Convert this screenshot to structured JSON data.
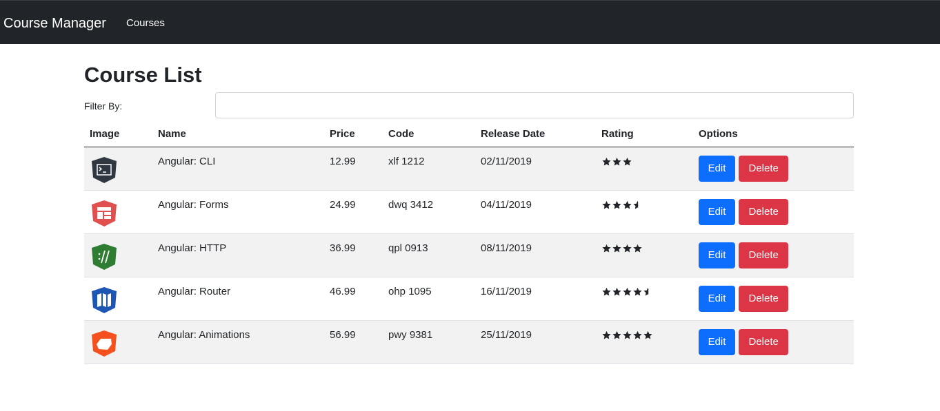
{
  "navbar": {
    "brand": "Course Manager",
    "links": [
      "Courses"
    ]
  },
  "page": {
    "title": "Course List",
    "filter_label": "Filter By:",
    "filter_value": ""
  },
  "table": {
    "headers": [
      "Image",
      "Name",
      "Price",
      "Code",
      "Release Date",
      "Rating",
      "Options"
    ],
    "rows": [
      {
        "icon": "cli-terminal-icon",
        "icon_color": "#2f3740",
        "name": "Angular: CLI",
        "price": "12.99",
        "code": "xlf 1212",
        "release_date": "02/11/2019",
        "rating": 3,
        "edit_label": "Edit",
        "delete_label": "Delete"
      },
      {
        "icon": "forms-icon",
        "icon_color": "#e0504f",
        "name": "Angular: Forms",
        "price": "24.99",
        "code": "dwq 3412",
        "release_date": "04/11/2019",
        "rating": 3.5,
        "edit_label": "Edit",
        "delete_label": "Delete"
      },
      {
        "icon": "http-icon",
        "icon_color": "#2e7d32",
        "name": "Angular: HTTP",
        "price": "36.99",
        "code": "qpl 0913",
        "release_date": "08/11/2019",
        "rating": 4,
        "edit_label": "Edit",
        "delete_label": "Delete"
      },
      {
        "icon": "router-map-icon",
        "icon_color": "#1e56b4",
        "name": "Angular: Router",
        "price": "46.99",
        "code": "ohp 1095",
        "release_date": "16/11/2019",
        "rating": 4.5,
        "edit_label": "Edit",
        "delete_label": "Delete"
      },
      {
        "icon": "animations-icon",
        "icon_color": "#f4511e",
        "name": "Angular: Animations",
        "price": "56.99",
        "code": "pwy 9381",
        "release_date": "25/11/2019",
        "rating": 5,
        "edit_label": "Edit",
        "delete_label": "Delete"
      }
    ]
  },
  "colors": {
    "navbar_bg": "#212529",
    "edit_button": "#0d6efd",
    "delete_button": "#dc3545",
    "striped_row": "#f2f2f2"
  }
}
